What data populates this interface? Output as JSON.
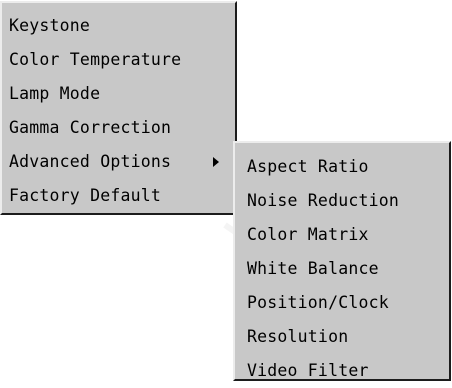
{
  "main_menu": {
    "items": [
      {
        "label": "Keystone"
      },
      {
        "label": "Color Temperature"
      },
      {
        "label": "Lamp Mode"
      },
      {
        "label": "Gamma Correction"
      },
      {
        "label": "Advanced Options",
        "has_submenu": true
      },
      {
        "label": "Factory Default"
      }
    ],
    "submenu_arrow_icon": "triangle-right-icon"
  },
  "sub_menu": {
    "items": [
      {
        "label": "Aspect Ratio"
      },
      {
        "label": "Noise Reduction"
      },
      {
        "label": "Color Matrix"
      },
      {
        "label": "White Balance"
      },
      {
        "label": "Position/Clock"
      },
      {
        "label": "Resolution"
      },
      {
        "label": "Video Filter"
      }
    ]
  },
  "colors": {
    "menu_background": "#c8c8c8",
    "highlight_border": "#ececec",
    "shadow_border": "#1c1c1c",
    "text": "#000000"
  }
}
